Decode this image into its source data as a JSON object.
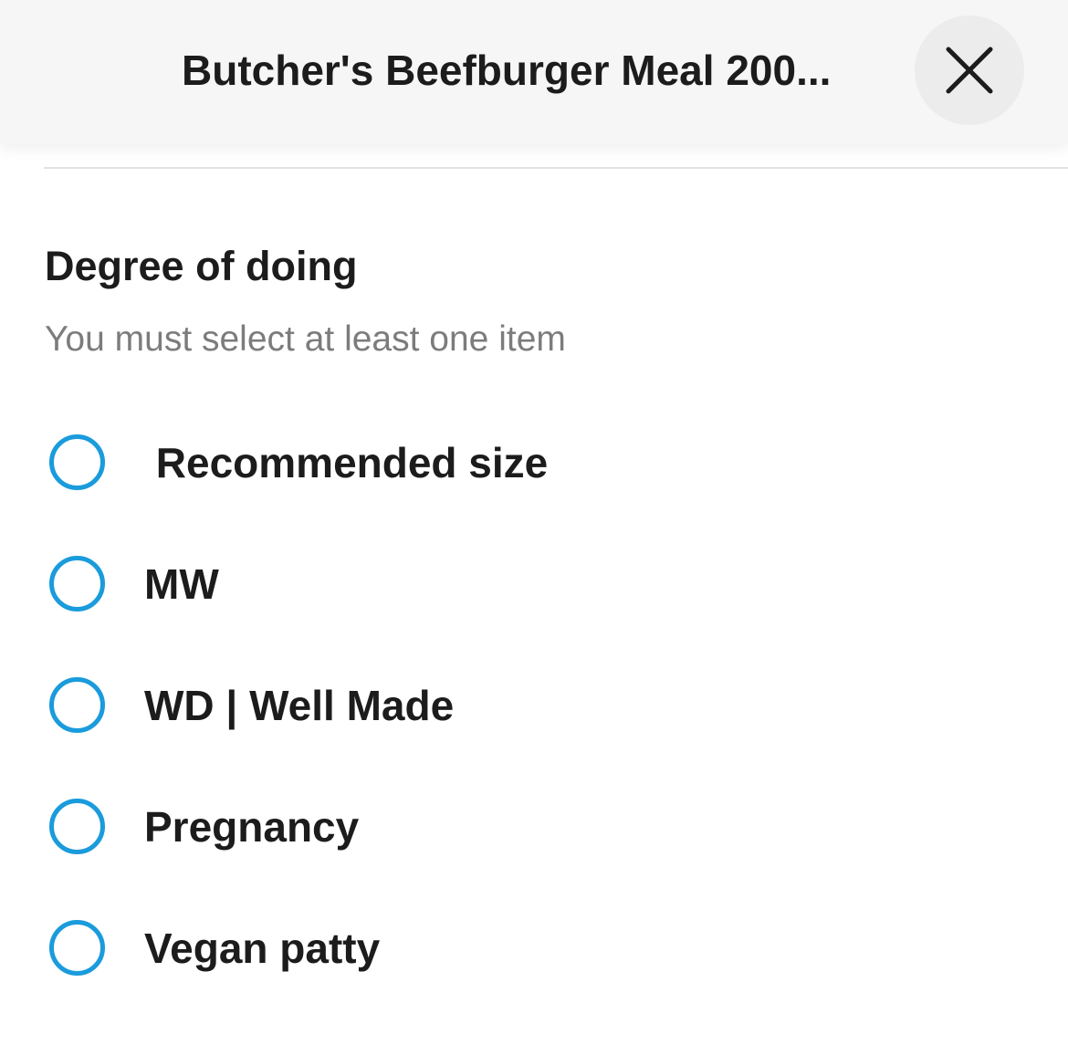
{
  "header": {
    "title": "Butcher's Beefburger Meal 200...",
    "close_icon": "close-icon"
  },
  "section": {
    "title": "Degree of doing",
    "subtitle": "You must select at least one item"
  },
  "options": [
    {
      "label": " Recommended size"
    },
    {
      "label": "MW"
    },
    {
      "label": "WD | Well Made"
    },
    {
      "label": "Pregnancy"
    },
    {
      "label": "Vegan patty"
    }
  ],
  "colors": {
    "accent": "#1a9bdc",
    "header_bg": "#f6f6f6",
    "close_bg": "#ececec",
    "subtitle": "#7c7c7c"
  }
}
